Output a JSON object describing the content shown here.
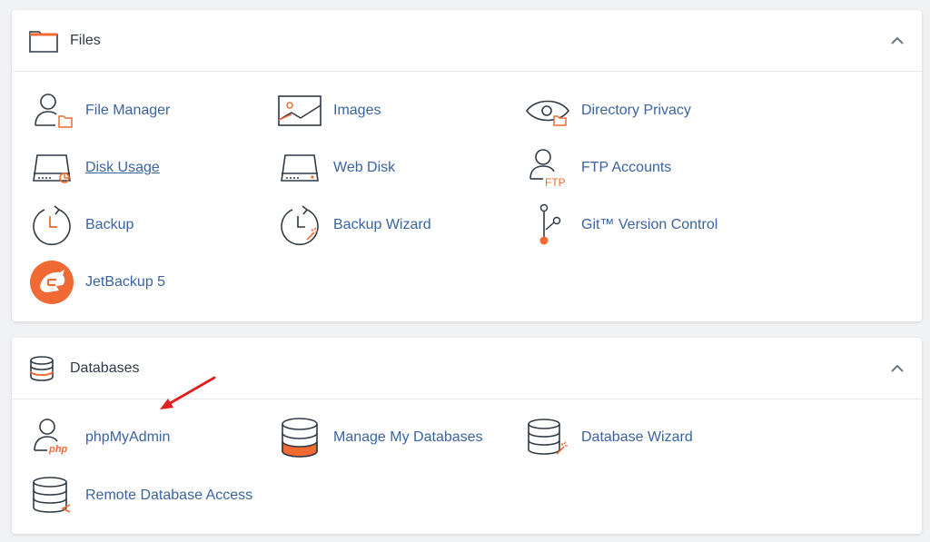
{
  "accent_color": "#f16a34",
  "link_color": "#3a63a0",
  "files": {
    "title": "Files",
    "header_icon": "folder-icon",
    "collapse_icon": "chevron-up-icon",
    "items": [
      {
        "label": "File Manager",
        "icon": "file-manager-icon"
      },
      {
        "label": "Images",
        "icon": "images-icon"
      },
      {
        "label": "Directory Privacy",
        "icon": "eye-icon"
      },
      {
        "label": "Disk Usage",
        "icon": "disk-usage-icon"
      },
      {
        "label": "Web Disk",
        "icon": "web-disk-icon"
      },
      {
        "label": "FTP Accounts",
        "icon": "ftp-accounts-icon"
      },
      {
        "label": "Backup",
        "icon": "backup-clock-icon"
      },
      {
        "label": "Backup Wizard",
        "icon": "backup-wizard-icon"
      },
      {
        "label": "Git™ Version Control",
        "icon": "git-branch-icon"
      },
      {
        "label": "JetBackup 5",
        "icon": "jetbackup-logo-icon"
      }
    ]
  },
  "databases": {
    "title": "Databases",
    "header_icon": "database-icon",
    "collapse_icon": "chevron-up-icon",
    "items": [
      {
        "label": "phpMyAdmin",
        "icon": "phpmyadmin-icon",
        "icon_text": "php"
      },
      {
        "label": "Manage My Databases",
        "icon": "manage-databases-icon"
      },
      {
        "label": "Database Wizard",
        "icon": "database-wizard-icon"
      },
      {
        "label": "Remote Database Access",
        "icon": "remote-database-icon"
      }
    ]
  },
  "annotation": {
    "icon": "red-arrow-icon",
    "color": "#e02020"
  },
  "ftp_icon_text": "FTP"
}
